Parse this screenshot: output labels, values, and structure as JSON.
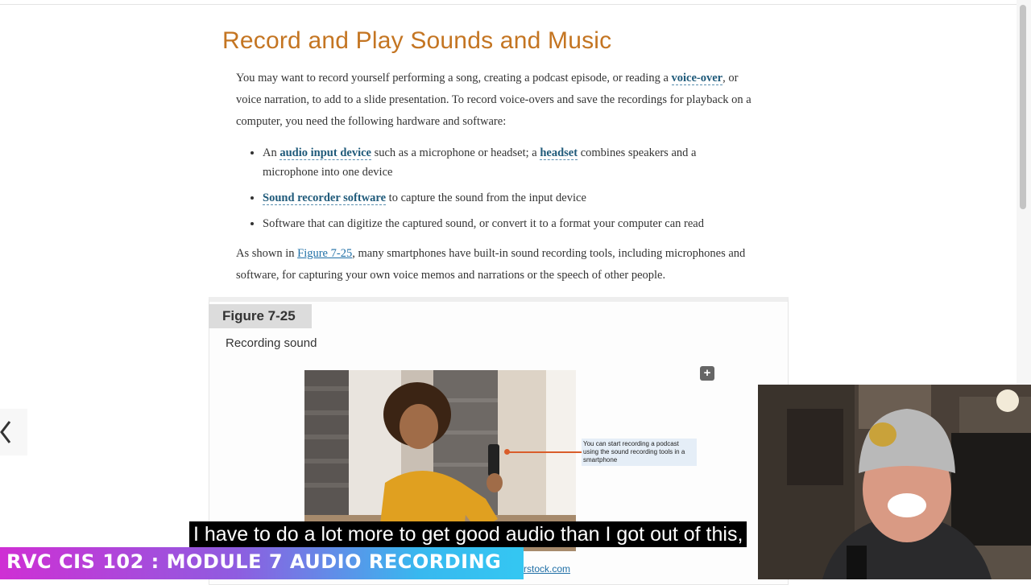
{
  "article": {
    "title": "Record and Play Sounds and Music",
    "intro": {
      "t1": "You may want to record yourself performing a song, creating a podcast episode, or reading a ",
      "term_voiceover": "voice-over",
      "t2": ", or voice narration, to add to a slide presentation. To record voice-overs and save the recordings for playback on a computer, you need the following hardware and software:"
    },
    "bullets": {
      "b1_pre": "An ",
      "b1_term1": "audio input device",
      "b1_mid": " such as a microphone or headset; a ",
      "b1_term2": "headset",
      "b1_post": " combines speakers and a microphone into one device",
      "b2_term": "Sound recorder software",
      "b2_post": " to capture the sound from the input device",
      "b3": "Software that can digitize the captured sound, or convert it to a format your computer can read"
    },
    "shown": {
      "t1": "As shown in ",
      "link": "Figure 7-25",
      "t2": ", many smartphones have built-in sound recording tools, including microphones and software, for capturing your own voice memos and narrations or the speech of other people."
    }
  },
  "figure": {
    "label": "Figure 7-25",
    "caption": "Recording sound",
    "expand_icon": "plus-icon",
    "callout": "You can start recording a podcast using the sound recording tools in a smartphone",
    "credit_link": "rstock.com"
  },
  "nav": {
    "prev_icon": "chevron-left-icon"
  },
  "video": {
    "subtitle": "I have to do a lot more to get good audio than I got out of this,",
    "banner": "RVC CIS 102 : MODULE 7 AUDIO RECORDING"
  },
  "colors": {
    "title": "#c47522",
    "term": "#1f5a7a",
    "link": "#1f6fa6",
    "callout_line": "#d95d2a"
  }
}
